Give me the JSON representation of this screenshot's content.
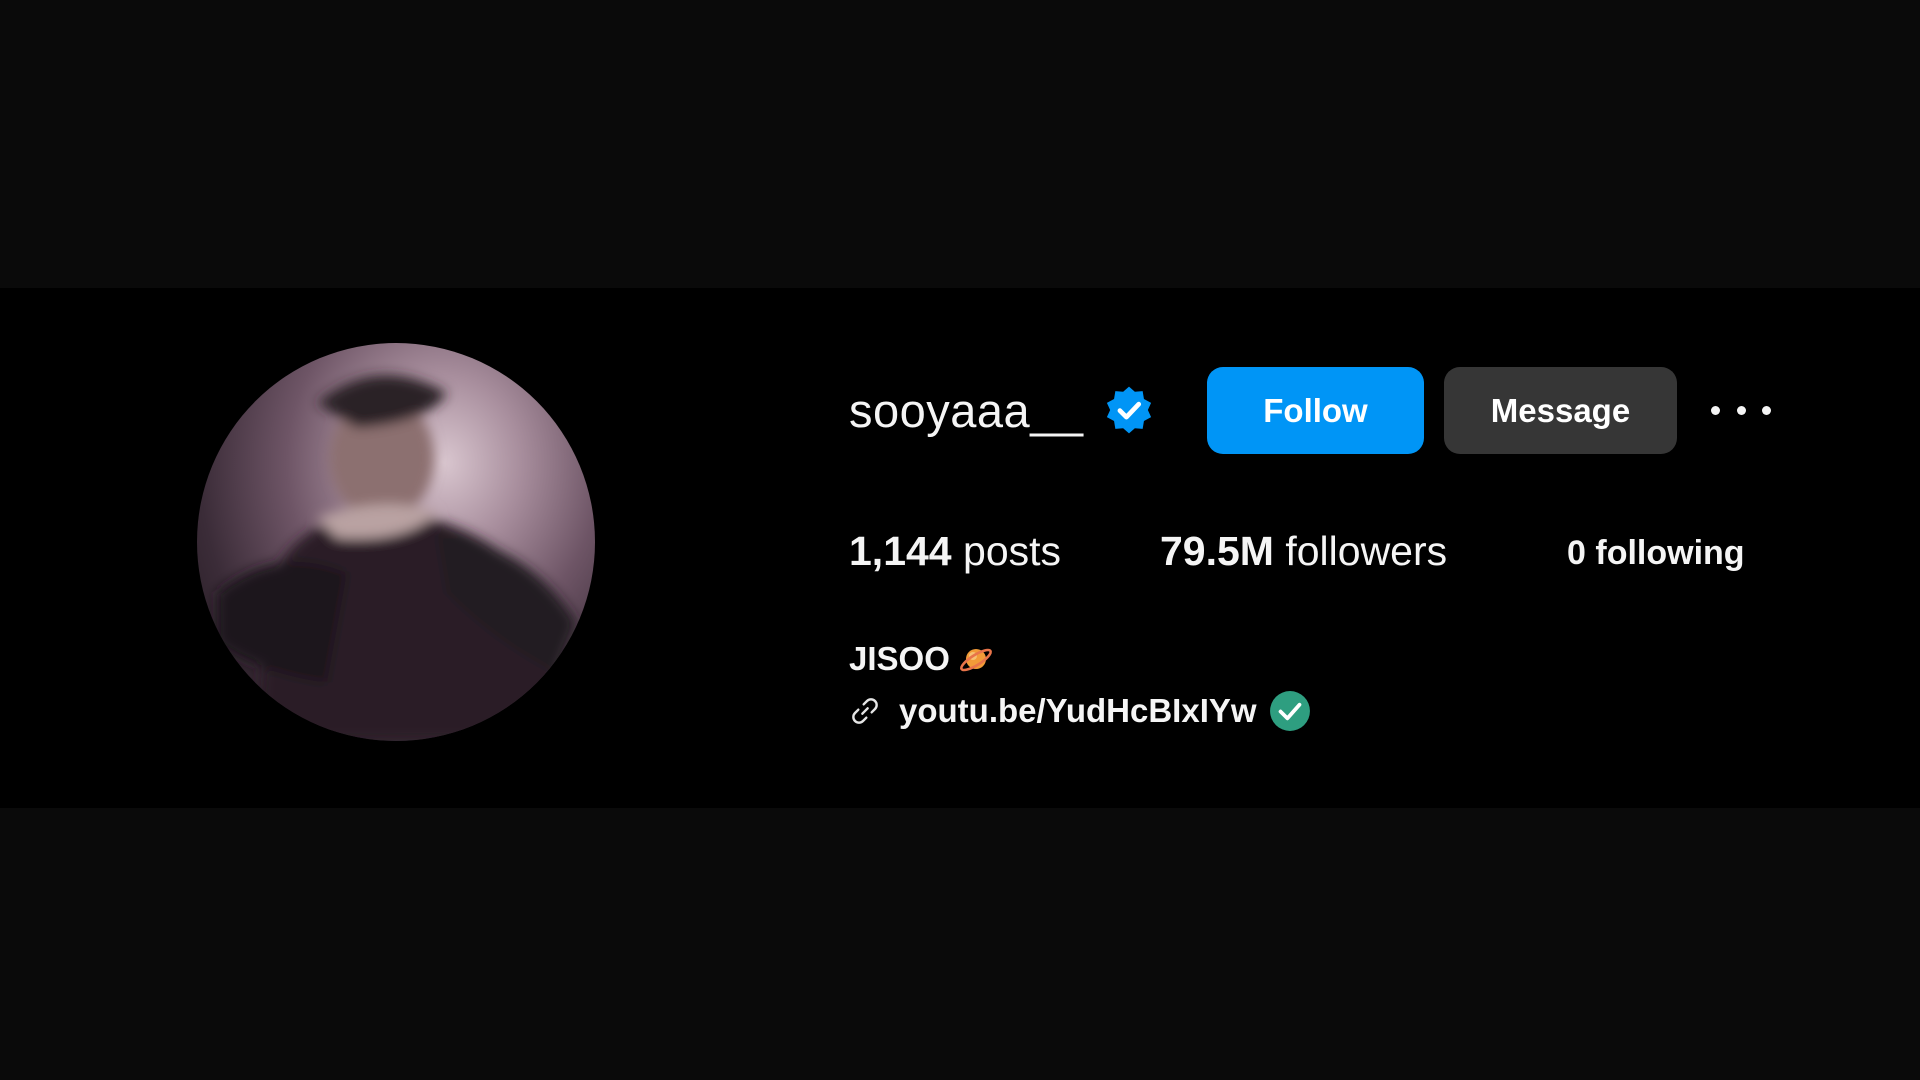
{
  "profile": {
    "username": "sooyaaa__",
    "verified_icon": "verified-badge-icon",
    "follow_label": "Follow",
    "message_label": "Message",
    "more_icon": "more-options-icon",
    "stats": {
      "posts_count": "1,144",
      "posts_label": "posts",
      "followers_count": "79.5M",
      "followers_label": "followers",
      "following_count": "0",
      "following_label": "following"
    },
    "bio_name": "JISOO",
    "bio_emoji_icon": "ringed-planet-icon",
    "link_icon": "link-icon",
    "link_text": "youtu.be/YudHcBIxIYw",
    "link_badge_icon": "check-circle-icon"
  },
  "colors": {
    "background": "#0a0a0a",
    "panel": "#000000",
    "follow_button": "#0095f6",
    "message_button": "#363636",
    "verified_blue": "#0095f6",
    "check_green": "#2e9e80"
  }
}
